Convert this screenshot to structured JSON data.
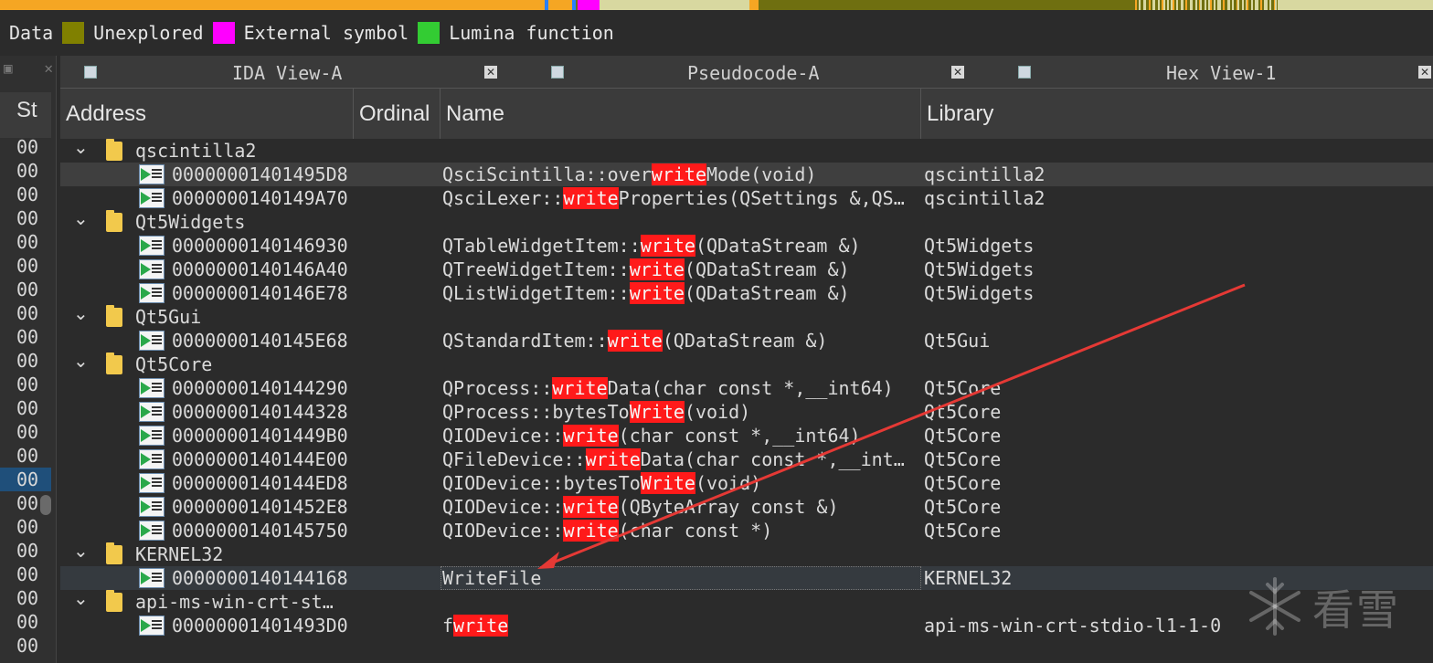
{
  "legend": {
    "items": [
      {
        "label": "Data",
        "color": null
      },
      {
        "label": "Unexplored",
        "color": "#808000"
      },
      {
        "label": "External symbol",
        "color": "#ff00ff"
      },
      {
        "label": "Lumina function",
        "color": "#33cc33"
      }
    ]
  },
  "navband": {
    "colors": {
      "code": "#f5a623",
      "data": "#d8d8a0",
      "unexplored": "#6f6f10",
      "external": "#ff00ff",
      "marker": "#2a7fff"
    }
  },
  "gutter": {
    "header": "St",
    "values": [
      "00",
      "00",
      "00",
      "00",
      "00",
      "00",
      "00",
      "00",
      "00",
      "00",
      "00",
      "00",
      "00",
      "00",
      "00",
      "00",
      "00",
      "00",
      "00",
      "00",
      "00",
      "00"
    ],
    "selected_index": 14
  },
  "tabs": [
    {
      "title": "IDA View-A",
      "icon": "disassembly-icon"
    },
    {
      "title": "Pseudocode-A",
      "icon": "pseudocode-icon"
    },
    {
      "title": "Hex View-1",
      "icon": "hex-view-icon"
    }
  ],
  "table": {
    "columns": [
      "Address",
      "Ordinal",
      "Name",
      "Library"
    ],
    "rows": [
      {
        "type": "group",
        "name": "qscintilla2"
      },
      {
        "type": "item",
        "address": "00000001401495D8",
        "name_parts": [
          "QsciScintilla::over",
          "write",
          "Mode(void)"
        ],
        "library": "qscintilla2"
      },
      {
        "type": "item",
        "address": "0000000140149A70",
        "name_parts": [
          "QsciLexer::",
          "write",
          "Properties(QSettings &,QS…"
        ],
        "library": "qscintilla2"
      },
      {
        "type": "group",
        "name": "Qt5Widgets"
      },
      {
        "type": "item",
        "address": "0000000140146930",
        "name_parts": [
          "QTableWidgetItem::",
          "write",
          "(QDataStream &)"
        ],
        "library": "Qt5Widgets"
      },
      {
        "type": "item",
        "address": "0000000140146A40",
        "name_parts": [
          "QTreeWidgetItem::",
          "write",
          "(QDataStream &)"
        ],
        "library": "Qt5Widgets"
      },
      {
        "type": "item",
        "address": "0000000140146E78",
        "name_parts": [
          "QListWidgetItem::",
          "write",
          "(QDataStream &)"
        ],
        "library": "Qt5Widgets"
      },
      {
        "type": "group",
        "name": "Qt5Gui"
      },
      {
        "type": "item",
        "address": "0000000140145E68",
        "name_parts": [
          "QStandardItem::",
          "write",
          "(QDataStream &)"
        ],
        "library": "Qt5Gui"
      },
      {
        "type": "group",
        "name": "Qt5Core"
      },
      {
        "type": "item",
        "address": "0000000140144290",
        "name_parts": [
          "QProcess::",
          "write",
          "Data(char const *,__int64)"
        ],
        "library": "Qt5Core"
      },
      {
        "type": "item",
        "address": "0000000140144328",
        "name_parts": [
          "QProcess::bytesTo",
          "Write",
          "(void)"
        ],
        "library": "Qt5Core"
      },
      {
        "type": "item",
        "address": "00000001401449B0",
        "name_parts": [
          "QIODevice::",
          "write",
          "(char const *,__int64)"
        ],
        "library": "Qt5Core"
      },
      {
        "type": "item",
        "address": "0000000140144E00",
        "name_parts": [
          "QFileDevice::",
          "write",
          "Data(char const *,__int…"
        ],
        "library": "Qt5Core"
      },
      {
        "type": "item",
        "address": "0000000140144ED8",
        "name_parts": [
          "QIODevice::bytesTo",
          "Write",
          "(void)"
        ],
        "library": "Qt5Core"
      },
      {
        "type": "item",
        "address": "00000001401452E8",
        "name_parts": [
          "QIODevice::",
          "write",
          "(QByteArray const &)"
        ],
        "library": "Qt5Core"
      },
      {
        "type": "item",
        "address": "0000000140145750",
        "name_parts": [
          "QIODevice::",
          "write",
          "(char const *)"
        ],
        "library": "Qt5Core"
      },
      {
        "type": "group",
        "name": "KERNEL32"
      },
      {
        "type": "item",
        "address": "0000000140144168",
        "name_parts": [
          "WriteFile",
          "",
          ""
        ],
        "library": "KERNEL32",
        "current": true
      },
      {
        "type": "group",
        "name": "api-ms-win-crt-st…"
      },
      {
        "type": "item",
        "address": "00000001401493D0",
        "name_parts": [
          "f",
          "write",
          ""
        ],
        "library": "api-ms-win-crt-stdio-l1-1-0"
      }
    ],
    "highlight_color": "#ff1a1a"
  },
  "watermark": {
    "text": "看雪"
  },
  "annotation": {
    "arrow_color": "#e53935"
  }
}
